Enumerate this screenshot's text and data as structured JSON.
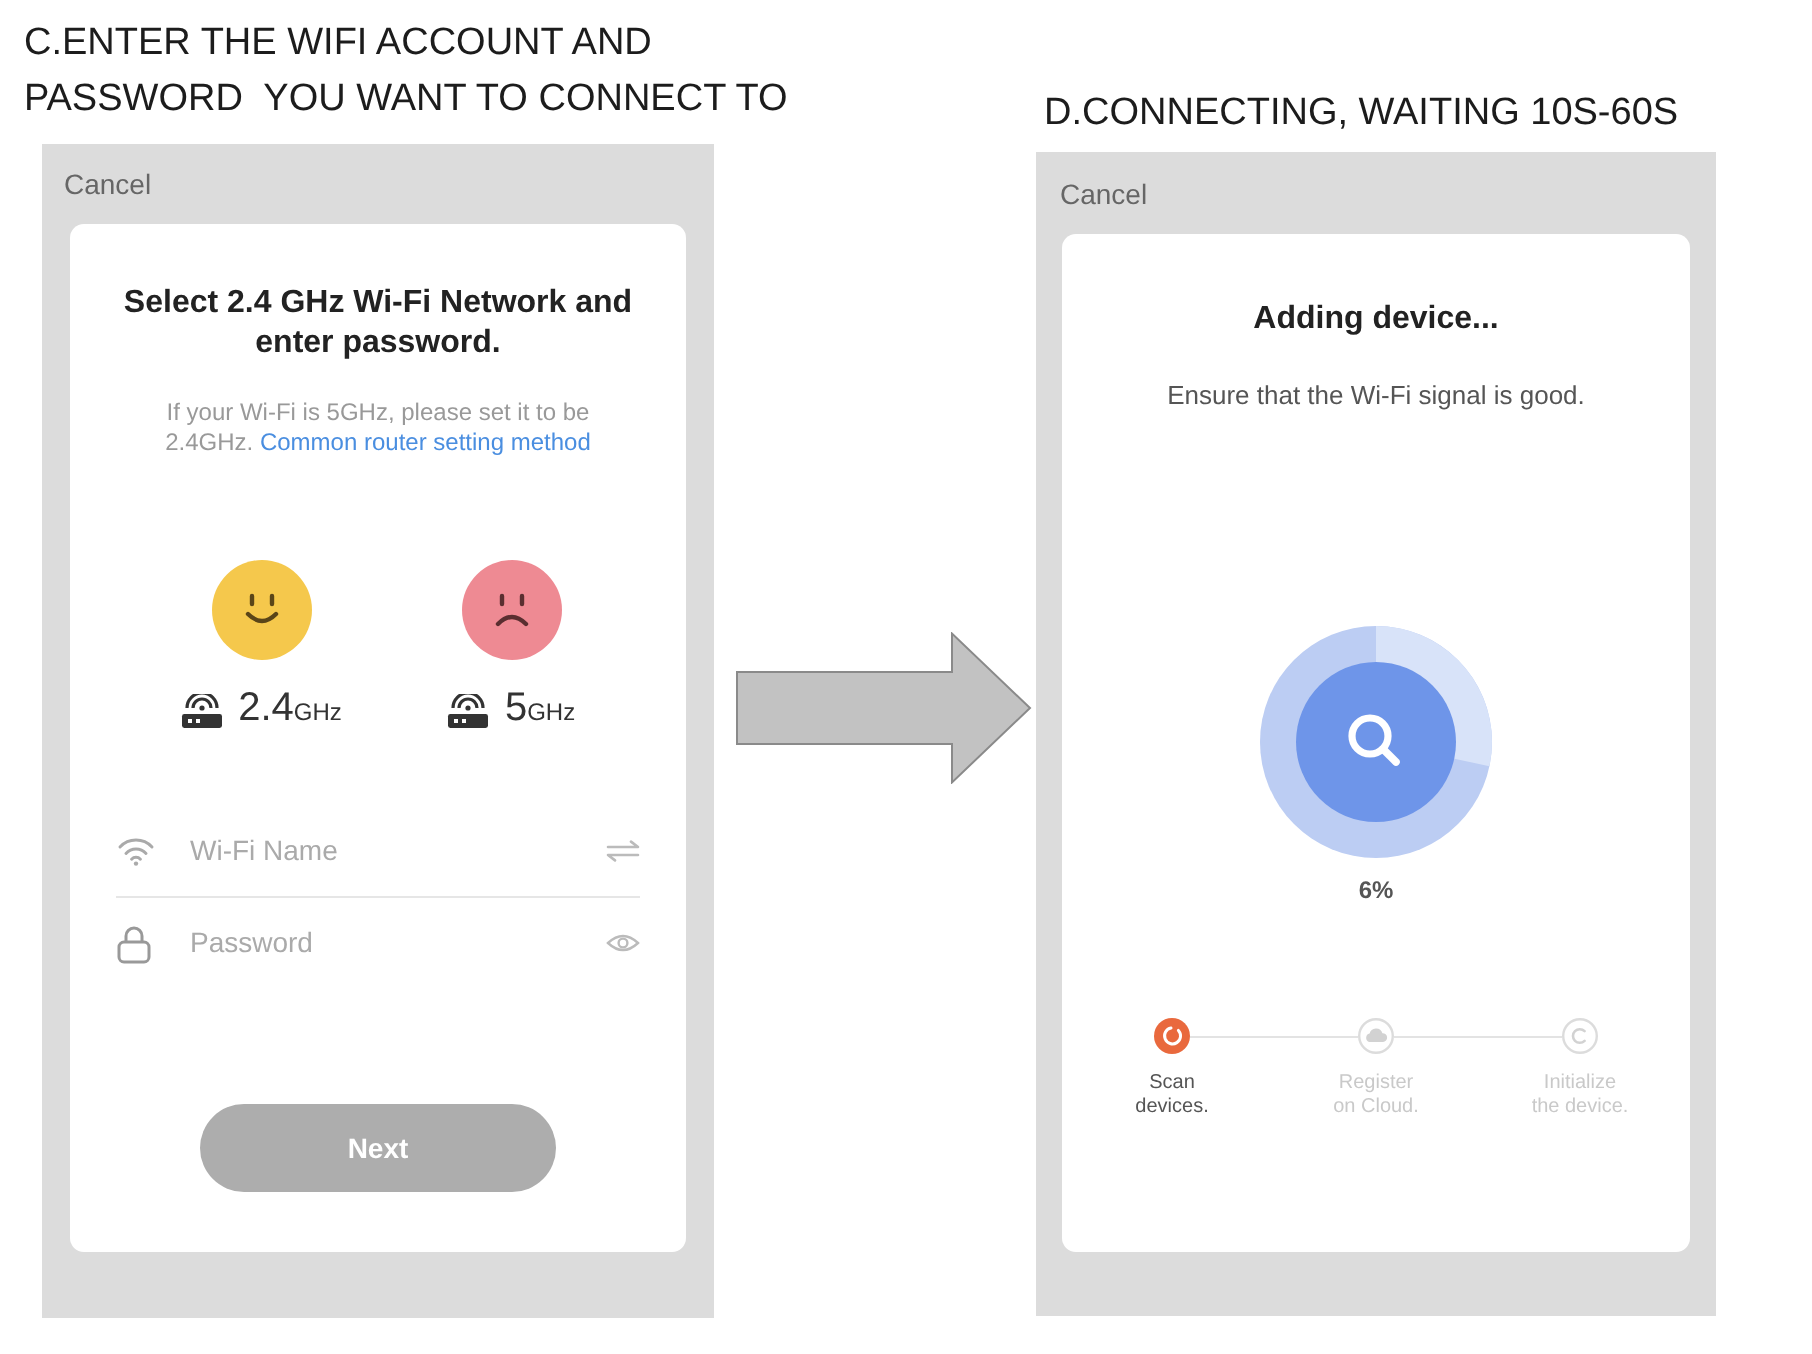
{
  "panels": [
    {
      "kind": "wifi_form",
      "caption": [
        "C.ENTER THE WIFI ACCOUNT AND",
        "PASSWORD  YOU WANT TO CONNECT TO"
      ],
      "cancel": "Cancel",
      "title": "Select 2.4 GHz Wi-Fi Network and enter password.",
      "hint": "If your Wi-Fi is 5GHz, please set it to be 2.4GHz.",
      "hint_link": "Common router setting method",
      "bands": [
        {
          "kind": "happy",
          "color": "#f5c84c",
          "value": "2.4",
          "unit": "GHz"
        },
        {
          "kind": "sad",
          "color": "#ee8a93",
          "value": "5",
          "unit": "GHz"
        }
      ],
      "fields": [
        {
          "kind": "wifi",
          "placeholder": "Wi-Fi Name"
        },
        {
          "kind": "password",
          "placeholder": "Password"
        }
      ],
      "button": {
        "label": "Next",
        "disabled": true
      }
    },
    {
      "kind": "progress",
      "caption": [
        "D.CONNECTING, WAITING 10S-60S"
      ],
      "cancel": "Cancel",
      "title": "Adding device...",
      "subtitle": "Ensure that the Wi-Fi signal is good.",
      "percent": "6%",
      "steps": [
        {
          "kind": "scan",
          "label": [
            "Scan",
            "devices."
          ],
          "active": true
        },
        {
          "kind": "register",
          "label": [
            "Register",
            "on Cloud."
          ],
          "active": false
        },
        {
          "kind": "initialize",
          "label": [
            "Initialize",
            "the device."
          ],
          "active": false
        }
      ]
    }
  ]
}
